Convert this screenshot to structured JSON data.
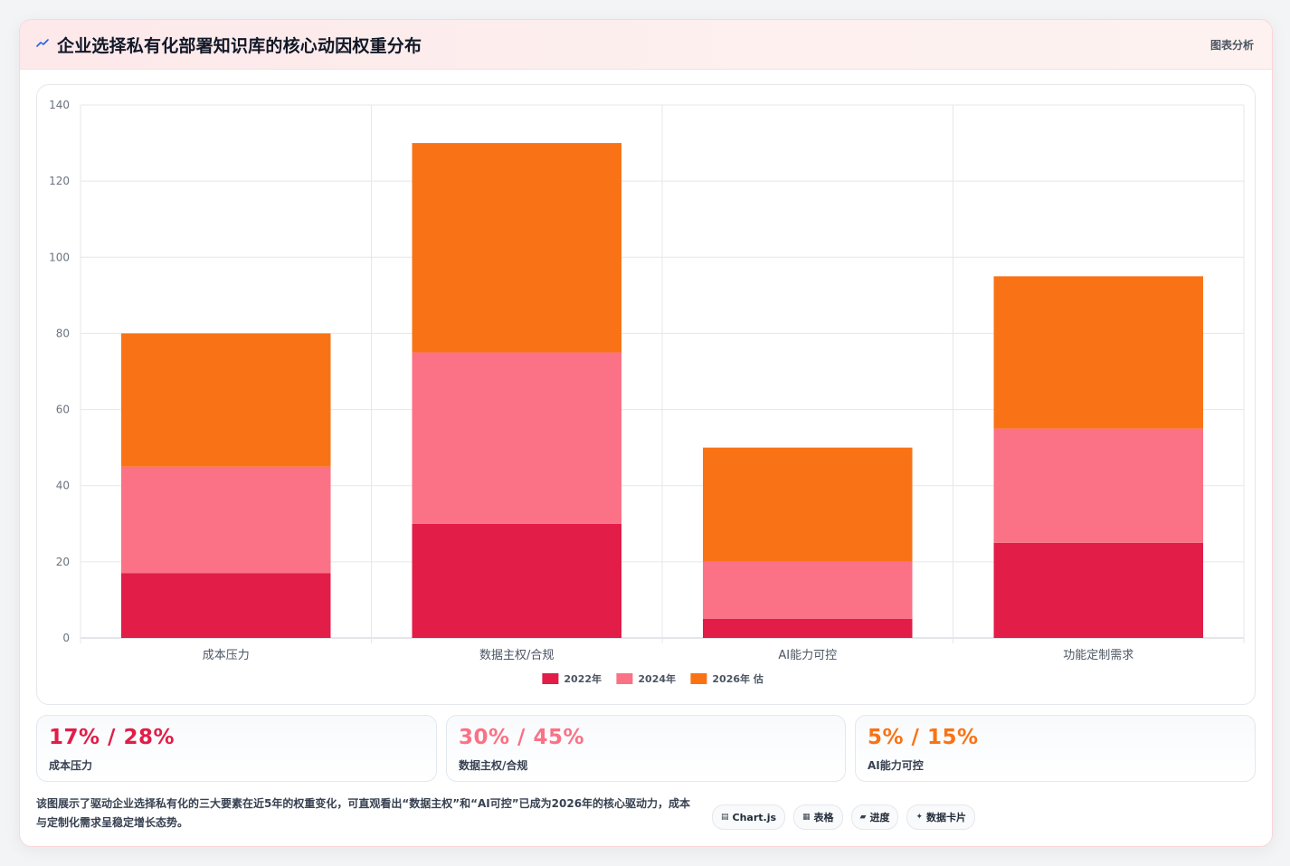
{
  "header": {
    "title": "企业选择私有化部署知识库的核心动因权重分布",
    "icon": "line-chart-icon",
    "right_link": "图表分析"
  },
  "chart_data": {
    "type": "bar",
    "stacked": true,
    "categories": [
      "成本压力",
      "数据主权/合规",
      "AI能力可控",
      "功能定制需求"
    ],
    "series": [
      {
        "name": "2022年",
        "color": "#e11d48",
        "values": [
          17,
          30,
          5,
          25
        ]
      },
      {
        "name": "2024年",
        "color": "#fb7185",
        "values": [
          28,
          45,
          15,
          30
        ]
      },
      {
        "name": "2026年 估",
        "color": "#f97316",
        "values": [
          35,
          55,
          30,
          40
        ]
      }
    ],
    "ylim": [
      0,
      140
    ],
    "yticks": [
      0,
      20,
      40,
      60,
      80,
      100,
      120,
      140
    ],
    "grid": true,
    "legend_position": "bottom"
  },
  "stats": [
    {
      "value": "17% / 28%",
      "label": "成本压力",
      "color": "#e11d48"
    },
    {
      "value": "30% / 45%",
      "label": "数据主权/合规",
      "color": "#fb7185"
    },
    {
      "value": "5% / 15%",
      "label": "AI能力可控",
      "color": "#f97316"
    }
  ],
  "description": "该图展示了驱动企业选择私有化的三大要素在近5年的权重变化，可直观看出“数据主权”和“AI可控”已成为2026年的核心驱动力，成本与定制化需求呈稳定增长态势。",
  "tags": [
    {
      "icon": "▤",
      "icon_name": "chart-icon",
      "label": "Chart.js"
    },
    {
      "icon": "▦",
      "icon_name": "table-icon",
      "label": "表格"
    },
    {
      "icon": "▰",
      "icon_name": "progress-icon",
      "label": "进度"
    },
    {
      "icon": "✦",
      "icon_name": "card-icon",
      "label": "数据卡片"
    }
  ]
}
